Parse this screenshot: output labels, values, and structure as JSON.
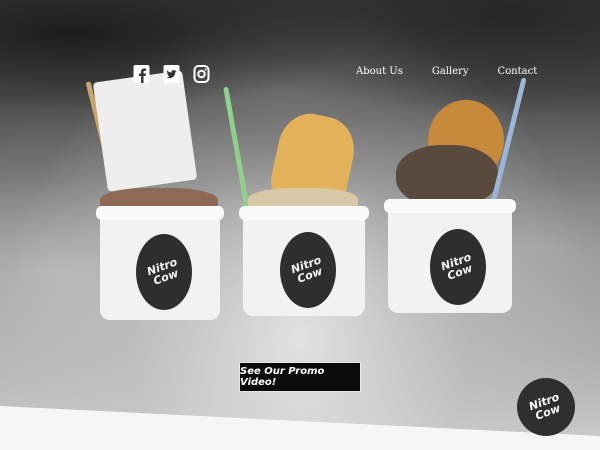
{
  "social": {
    "facebook_icon": "facebook-icon",
    "twitter_icon": "twitter-icon",
    "instagram_icon": "instagram-icon"
  },
  "nav": {
    "about": "About Us",
    "gallery": "Gallery",
    "contact": "Contact"
  },
  "cups": {
    "logo_text": "Nitro Cow"
  },
  "promo": {
    "label": "See Our Promo Video!"
  },
  "footer_logo": {
    "text": "Nitro Cow"
  },
  "colors": {
    "nav_text": "#ffffff",
    "promo_bg": "#0b0b0b",
    "band": "#f6f6f6"
  }
}
